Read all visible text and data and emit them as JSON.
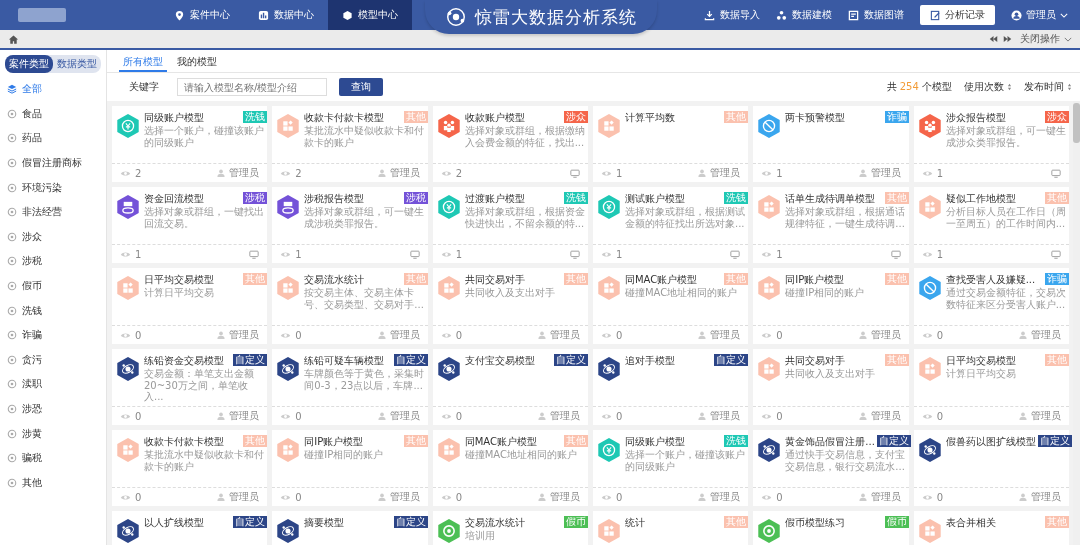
{
  "header": {
    "nav": [
      {
        "label": "案件中心",
        "selected": false
      },
      {
        "label": "数据中心",
        "selected": false
      },
      {
        "label": "模型中心",
        "selected": true
      }
    ],
    "title": "惊雷大数据分析系统",
    "actions": [
      {
        "label": "数据导入"
      },
      {
        "label": "数据建模"
      },
      {
        "label": "数据图谱"
      }
    ],
    "record_button": "分析记录",
    "user": "管理员"
  },
  "toolbar": {
    "close_label": "关闭操作"
  },
  "sidebar": {
    "tabs": [
      {
        "label": "案件类型",
        "selected": true
      },
      {
        "label": "数据类型",
        "selected": false
      }
    ],
    "items": [
      {
        "label": "全部",
        "selected": true
      },
      {
        "label": "食品",
        "selected": false
      },
      {
        "label": "药品",
        "selected": false
      },
      {
        "label": "假冒注册商标",
        "selected": false
      },
      {
        "label": "环境污染",
        "selected": false
      },
      {
        "label": "非法经营",
        "selected": false
      },
      {
        "label": "涉众",
        "selected": false
      },
      {
        "label": "涉税",
        "selected": false
      },
      {
        "label": "假币",
        "selected": false
      },
      {
        "label": "洗钱",
        "selected": false
      },
      {
        "label": "诈骗",
        "selected": false
      },
      {
        "label": "贪污",
        "selected": false
      },
      {
        "label": "渎职",
        "selected": false
      },
      {
        "label": "涉恐",
        "selected": false
      },
      {
        "label": "涉黄",
        "selected": false
      },
      {
        "label": "骗税",
        "selected": false
      },
      {
        "label": "其他",
        "selected": false
      }
    ]
  },
  "tabs": [
    {
      "label": "所有模型",
      "selected": true
    },
    {
      "label": "我的模型",
      "selected": false
    }
  ],
  "search": {
    "label": "关键字",
    "placeholder": "请输入模型名称/模型介绍",
    "button": "查询"
  },
  "summary": {
    "prefix": "共",
    "count": "254",
    "suffix": "个模型"
  },
  "sorts": [
    "使用次数",
    "发布时间"
  ],
  "cards": [
    {
      "title": "同级账户模型",
      "desc": "选择一个账户，碰撞该账户的同级账户",
      "tag": "洗钱",
      "color": "#1ec8b4",
      "kind": "money",
      "views": "2",
      "owner": "管理员"
    },
    {
      "title": "收款卡付款卡模型",
      "desc": "某批流水中疑似收款卡和付款卡的账户",
      "tag": "其他",
      "color": "#fbc1ae",
      "kind": "grid",
      "views": "2",
      "owner": "管理员"
    },
    {
      "title": "收款账户模型",
      "desc": "选择对象或群组，根据缴纳入会费金额的特征，找出...",
      "tag": "涉众",
      "color": "#f5654a",
      "kind": "people",
      "views": "2"
    },
    {
      "title": "计算平均数",
      "tag": "其他",
      "color": "#fbc1ae",
      "kind": "grid",
      "views": "1",
      "owner": "管理员"
    },
    {
      "title": "两卡预警模型",
      "tag": "诈骗",
      "color": "#3aa6ee",
      "kind": "forbid",
      "views": "1",
      "owner": "管理员"
    },
    {
      "title": "涉众报告模型",
      "desc": "选择对象或群组，可一键生成涉众类罪报告。",
      "tag": "涉众",
      "color": "#f5654a",
      "kind": "people",
      "views": "1"
    },
    {
      "title": "资金回流模型",
      "desc": "选择对象或群组，一键找出回流交易。",
      "tag": "涉税",
      "color": "#7452d8",
      "kind": "tax",
      "views": "1"
    },
    {
      "title": "涉税报告模型",
      "desc": "选择对象或群组，可一键生成涉税类罪报告。",
      "tag": "涉税",
      "color": "#7452d8",
      "kind": "tax",
      "views": "1"
    },
    {
      "title": "过渡账户模型",
      "desc": "选择对象或群组，根据资金快进快出，不留余额的特...",
      "tag": "洗钱",
      "color": "#1ec8b4",
      "kind": "money",
      "views": "1"
    },
    {
      "title": "测试账户模型",
      "desc": "选择对象或群组，根据测试金额的特征找出所选对象...",
      "tag": "洗钱",
      "color": "#1ec8b4",
      "kind": "money",
      "views": "1"
    },
    {
      "title": "话单生成待调单模型",
      "desc": "选择对象或群组，根据通话规律特征，一键生成待调...",
      "tag": "其他",
      "color": "#fbc1ae",
      "kind": "grid",
      "views": "1"
    },
    {
      "title": "疑似工作地模型",
      "desc": "分析目标人员在工作日（周一至周五）的工作时间内...",
      "tag": "其他",
      "color": "#fbc1ae",
      "kind": "grid",
      "views": "1"
    },
    {
      "title": "日平均交易模型",
      "desc": "计算日平均交易",
      "tag": "其他",
      "color": "#fbc1ae",
      "kind": "grid",
      "views": "0",
      "owner": "管理员"
    },
    {
      "title": "交易流水统计",
      "desc": "按交易主体、交易主体卡号、交易类型、交易对手...",
      "tag": "其他",
      "color": "#fbc1ae",
      "kind": "grid",
      "views": "0",
      "owner": "管理员"
    },
    {
      "title": "共同交易对手",
      "desc": "共同收入及支出对手",
      "tag": "其他",
      "color": "#fbc1ae",
      "kind": "grid",
      "views": "0",
      "owner": "管理员"
    },
    {
      "title": "同MAC账户模型",
      "desc": "碰撞MAC地址相同的账户",
      "tag": "其他",
      "color": "#fbc1ae",
      "kind": "grid",
      "views": "0",
      "owner": "管理员"
    },
    {
      "title": "同IP账户模型",
      "desc": "碰撞IP相同的账户",
      "tag": "其他",
      "color": "#fbc1ae",
      "kind": "grid",
      "views": "0",
      "owner": "管理员"
    },
    {
      "title": "查找受害人及嫌疑...",
      "desc": "通过交易金额特征，交易次数特征来区分受害人账户...",
      "tag": "诈骗",
      "color": "#3aa6ee",
      "kind": "forbid",
      "views": "0",
      "owner": "管理员"
    },
    {
      "title": "练铅资金交易模型",
      "desc": "交易金额：单笔支出金额20~30万之间，单笔收入...",
      "tag": "自定义",
      "color": "#2c4587",
      "kind": "network",
      "views": "0",
      "owner": "管理员"
    },
    {
      "title": "练铅可疑车辆模型",
      "desc": "车牌颜色等于黄色，采集时间0-3，23点以后，车牌...",
      "tag": "自定义",
      "color": "#2c4587",
      "kind": "network",
      "views": "0",
      "owner": "管理员"
    },
    {
      "title": "支付宝交易模型",
      "tag": "自定义",
      "color": "#2c4587",
      "kind": "network",
      "views": "0",
      "owner": "管理员"
    },
    {
      "title": "追对手模型",
      "tag": "自定义",
      "color": "#2c4587",
      "kind": "network",
      "views": "0",
      "owner": "管理员"
    },
    {
      "title": "共同交易对手",
      "desc": "共同收入及支出对手",
      "tag": "其他",
      "color": "#fbc1ae",
      "kind": "grid",
      "views": "0",
      "owner": "管理员"
    },
    {
      "title": "日平均交易模型",
      "desc": "计算日平均交易",
      "tag": "其他",
      "color": "#fbc1ae",
      "kind": "grid",
      "views": "0",
      "owner": "管理员"
    },
    {
      "title": "收款卡付款卡模型",
      "desc": "某批流水中疑似收款卡和付款卡的账户",
      "tag": "其他",
      "color": "#fbc1ae",
      "kind": "grid",
      "views": "0",
      "owner": "管理员"
    },
    {
      "title": "同IP账户模型",
      "desc": "碰撞IP相同的账户",
      "tag": "其他",
      "color": "#fbc1ae",
      "kind": "grid",
      "views": "0",
      "owner": "管理员"
    },
    {
      "title": "同MAC账户模型",
      "desc": "碰撞MAC地址相同的账户",
      "tag": "其他",
      "color": "#fbc1ae",
      "kind": "grid",
      "views": "0",
      "owner": "管理员"
    },
    {
      "title": "同级账户模型",
      "desc": "选择一个账户，碰撞该账户的同级账户",
      "tag": "洗钱",
      "color": "#1ec8b4",
      "kind": "money",
      "views": "0",
      "owner": "管理员"
    },
    {
      "title": "黄金饰品假冒注册...",
      "desc": "通过快手交易信息，支付宝交易信息，银行交易流水...",
      "tag": "自定义",
      "color": "#2c4587",
      "kind": "network",
      "views": "0",
      "owner": "管理员"
    },
    {
      "title": "假兽药以图扩线模型",
      "tag": "自定义",
      "color": "#2c4587",
      "kind": "network",
      "views": "0",
      "owner": "管理员"
    },
    {
      "title": "以人扩线模型",
      "tag": "自定义",
      "color": "#2c4587",
      "kind": "network"
    },
    {
      "title": "摘要模型",
      "tag": "自定义",
      "color": "#2c4587",
      "kind": "network"
    },
    {
      "title": "交易流水统计",
      "desc": "培训用",
      "tag": "假币",
      "color": "#4cbf55",
      "kind": "target"
    },
    {
      "title": "统计",
      "tag": "其他",
      "color": "#fbc1ae",
      "kind": "grid"
    },
    {
      "title": "假币模型练习",
      "tag": "假币",
      "color": "#4cbf55",
      "kind": "target"
    },
    {
      "title": "表合并相关",
      "tag": "其他",
      "color": "#fbc1ae",
      "kind": "grid"
    }
  ]
}
